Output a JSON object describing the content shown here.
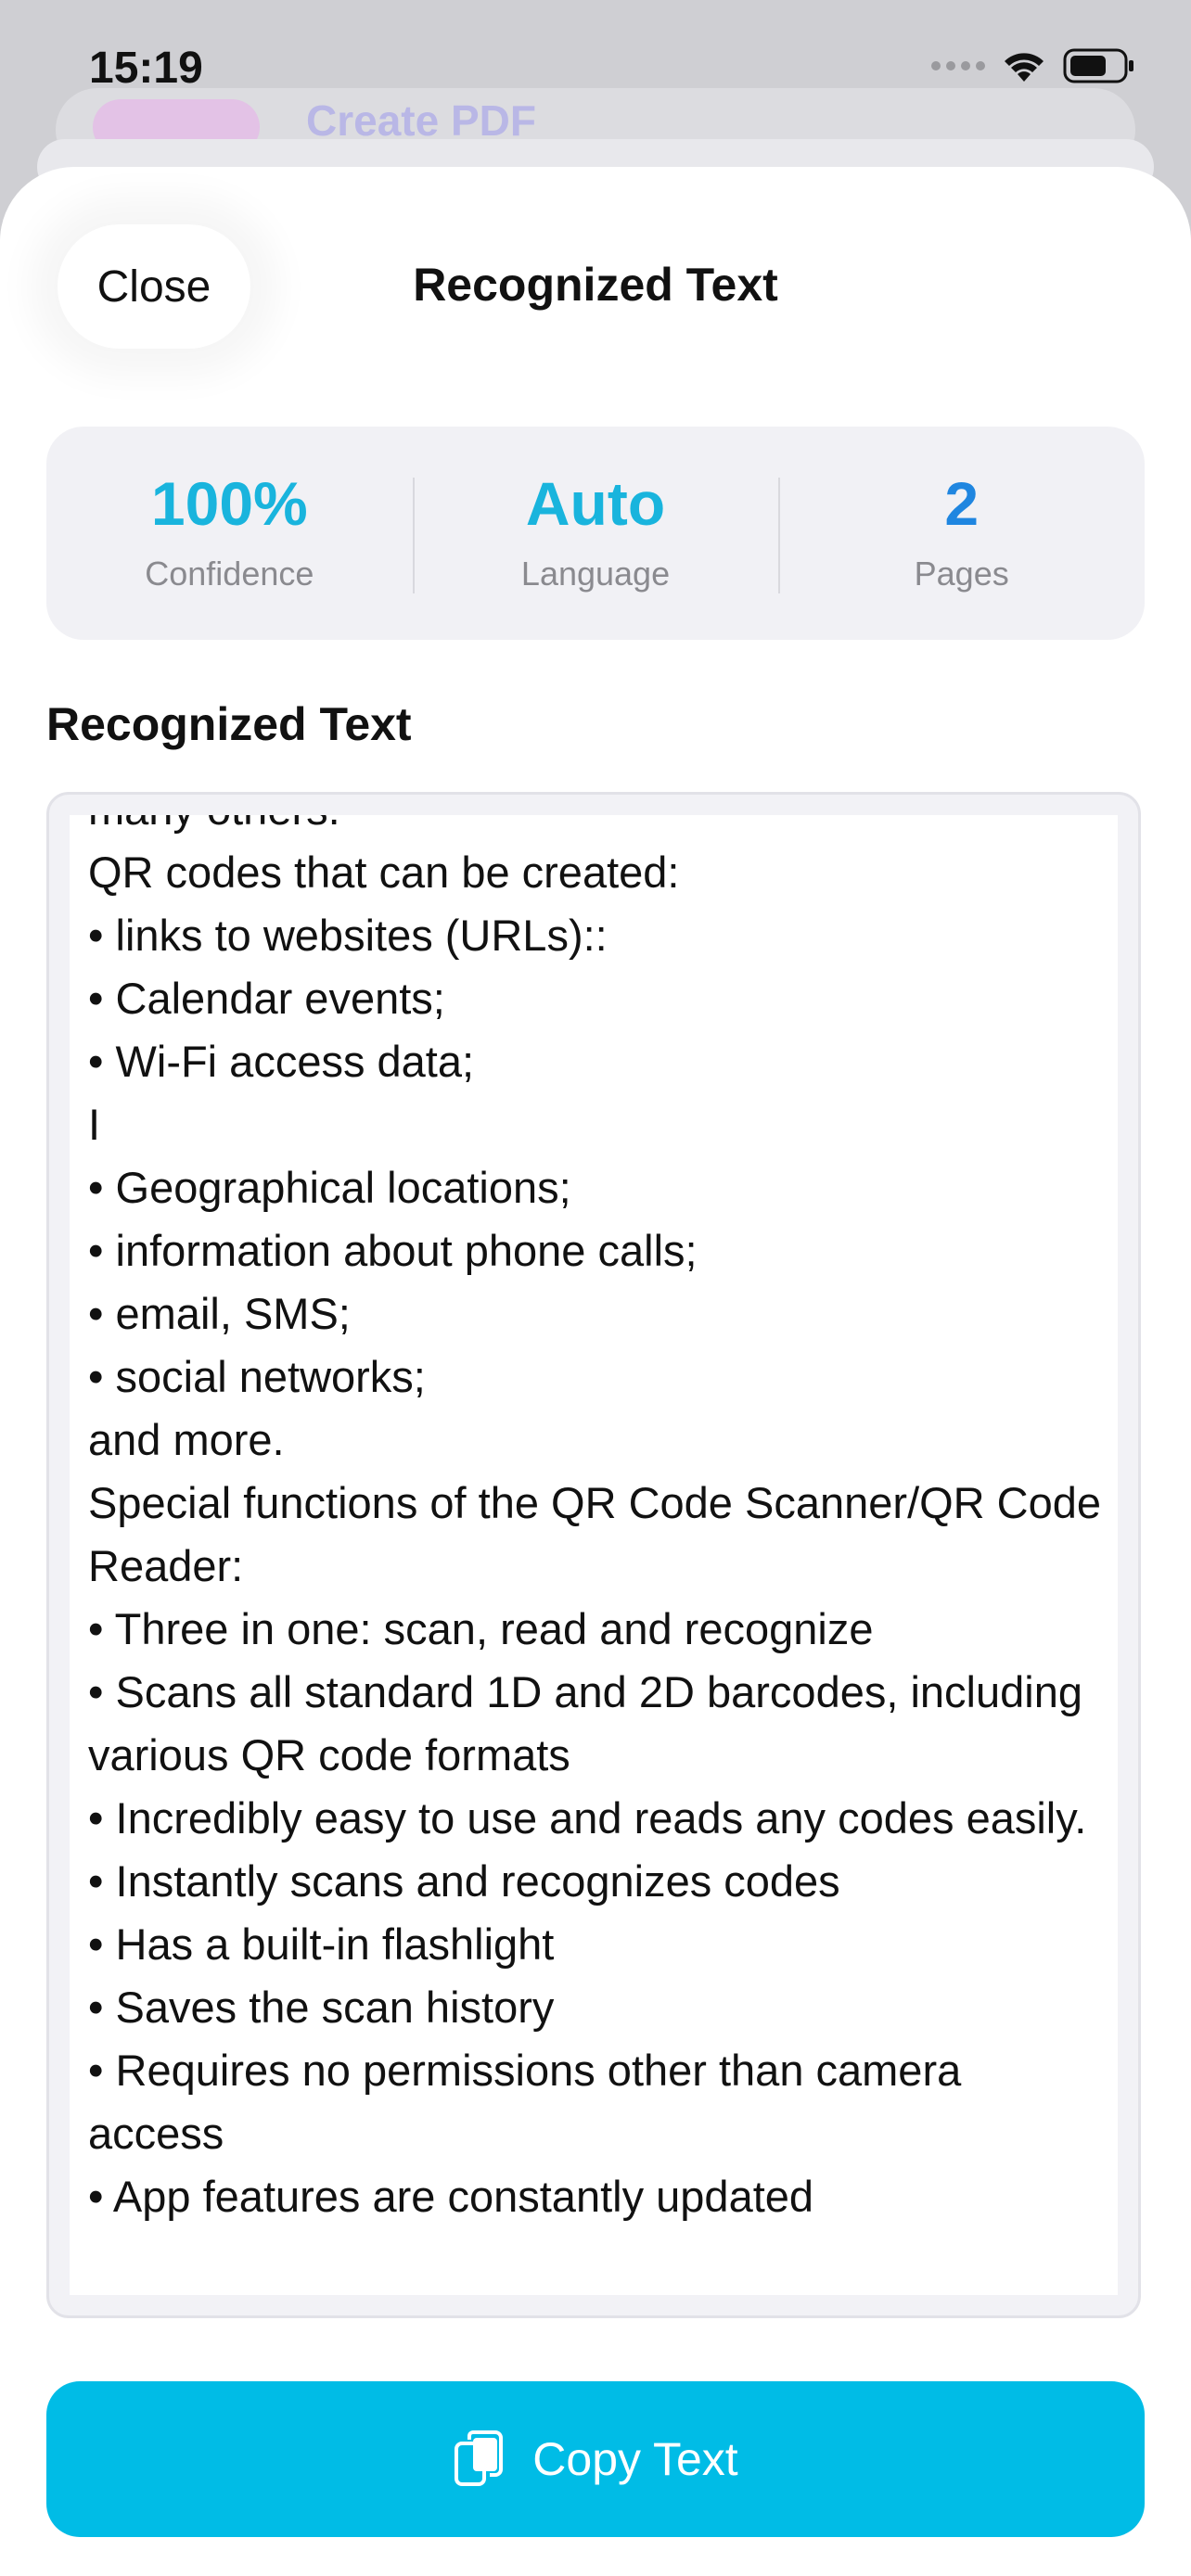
{
  "status_bar": {
    "time": "15:19"
  },
  "background": {
    "ghost_title": "Create PDF"
  },
  "sheet": {
    "close_label": "Close",
    "title": "Recognized Text"
  },
  "stats": [
    {
      "value": "100%",
      "label": "Confidence"
    },
    {
      "value": "Auto",
      "label": "Language"
    },
    {
      "value": "2",
      "label": "Pages"
    }
  ],
  "section": {
    "heading": "Recognized Text"
  },
  "recognized_text": "many others.\nQR codes that can be created:\n• links to websites (URLs)::\n• Calendar events;\n• Wi-Fi access data;\nI\n• Geographical locations;\n• information about phone calls;\n• email, SMS;\n• social networks;\nand more.\nSpecial functions of the QR Code Scanner/QR Code Reader:\n• Three in one: scan, read and recognize\n• Scans all standard 1D and 2D barcodes, including various QR code formats\n• Incredibly easy to use and reads any codes easily.\n• Instantly scans and recognizes codes\n• Has a built-in flashlight\n• Saves the scan history\n• Requires no permissions other than camera access\n• App features are constantly updated",
  "copy_button": {
    "label": "Copy Text",
    "icon": "copy-icon"
  },
  "colors": {
    "accent": "#00bce6",
    "stat_cyan": "#19b4dd",
    "stat_blue": "#1f86e0"
  }
}
